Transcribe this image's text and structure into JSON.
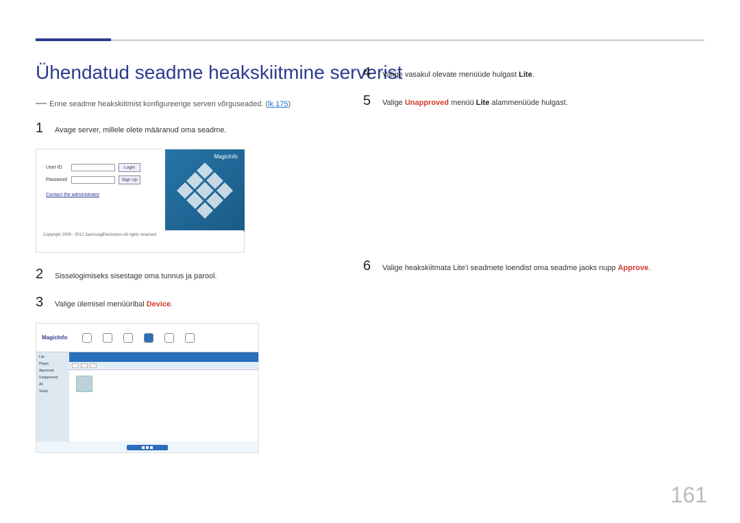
{
  "title": "Ühendatud seadme heakskiitmine serverist",
  "note": {
    "prefix": "Enne seadme heakskiitmist konfigureerige serveri võrguseaded. (",
    "link": "lk 175",
    "suffix": ")"
  },
  "steps_left": [
    {
      "num": "1",
      "text": "Avage server, millele olete määranud oma seadme."
    },
    {
      "num": "2",
      "text": "Sisselogimiseks sisestage oma tunnus ja parool."
    },
    {
      "num": "3",
      "pre": "Valige ülemisel menüüribal ",
      "hl": "Device",
      "post": "."
    }
  ],
  "steps_right": [
    {
      "num": "4",
      "pre": "Valige vasakul olevate menüüde hulgast ",
      "bold": "Lite",
      "post": "."
    },
    {
      "num": "5",
      "pre": "Valige ",
      "hl": "Unapproved",
      "mid": " menüü ",
      "bold": "Lite",
      "post": " alammenüüde hulgast."
    },
    {
      "num": "6",
      "pre": "Valige heakskiitmata Lite'i seadmete loendist oma seadme jaoks nupp ",
      "hl": "Approve",
      "post": "."
    }
  ],
  "login": {
    "user_id": "User ID",
    "password": "Password",
    "login_btn": "Login",
    "signup_btn": "Sign Up",
    "contact": "Contact the administrator",
    "brand": "MagicInfo",
    "copyright": "Copyright 2009 - 2012 SamsungElectronics All rights reserved"
  },
  "device": {
    "brand": "MagicInfo",
    "side_items": [
      "Lite",
      "Player",
      "Approved",
      "Unapproved",
      "All",
      "Setup"
    ]
  },
  "page_number": "161"
}
